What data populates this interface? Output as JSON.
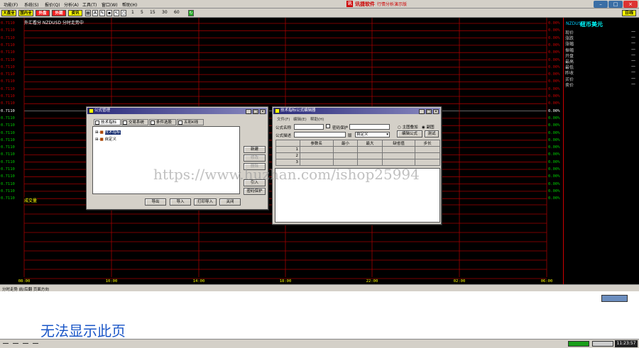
{
  "menubar": {
    "items": [
      "功能(F)",
      "系统(S)",
      "报价(Q)",
      "分析(A)",
      "工具(T)",
      "窗口(W)",
      "帮助(H)"
    ],
    "app_logo": "讯",
    "app_title": "讯捷软件",
    "app_subtitle": "行情分析演示版"
  },
  "toolbar": {
    "buttons": [
      {
        "label": "大盘全",
        "bg": "#ffff00",
        "fg": "#000000"
      },
      {
        "label": "国内全",
        "bg": "#ffff00",
        "fg": "#000000"
      },
      {
        "label": "外盘",
        "bg": "#ff2020",
        "fg": "#ffffff"
      },
      {
        "label": "外期",
        "bg": "#ff2020",
        "fg": "#ffffff"
      },
      {
        "label": "资讯",
        "bg": "#ffff00",
        "fg": "#000000"
      }
    ],
    "icons": [
      "grid-icon",
      "text-icon",
      "pencil-icon",
      "lock-icon",
      "arrow-icon",
      "search-icon"
    ],
    "periods": [
      "1",
      "5",
      "15",
      "30",
      "60"
    ],
    "refresh_icon": "refresh-icon",
    "right_button": "日线"
  },
  "chart": {
    "info": "外汇看分 NZDUSD 分时走势中",
    "price_labels": [
      "0.7110",
      "0.7110",
      "0.7110",
      "0.7110",
      "0.7110",
      "0.7110",
      "0.7110",
      "0.7110",
      "0.7110",
      "0.7110",
      "0.7110",
      "0.7110",
      "0.7110",
      "0.7110",
      "0.7110",
      "0.7110",
      "0.7110",
      "0.7110",
      "0.7110",
      "0.7110",
      "0.7110",
      "0.7110",
      "0.7110",
      "0.7110",
      "0.7110"
    ],
    "pct_labels": [
      "0.00%",
      "0.00%",
      "0.00%",
      "0.00%",
      "0.00%",
      "0.00%",
      "0.00%",
      "0.00%",
      "0.00%",
      "0.00%",
      "0.00%",
      "0.00%",
      "0.00%",
      "0.00%",
      "0.00%",
      "0.00%",
      "0.00%",
      "0.00%",
      "0.00%",
      "0.00%",
      "0.00%",
      "0.00%",
      "0.00%",
      "0.00%",
      "0.00%"
    ],
    "time_labels": [
      "08:00",
      "10:00",
      "14:00",
      "18:00",
      "22:00",
      "02:00",
      "06:00"
    ],
    "volume_label": "成交量",
    "colors": {
      "up": "#cc0000",
      "down": "#00cc00",
      "base": "#ffffff",
      "grid": "#a00000",
      "axis": "#ffff00"
    }
  },
  "rightpanel": {
    "code": "NZDUSD",
    "name": "纽币美元",
    "rows": [
      {
        "label": "现价",
        "value": "—"
      },
      {
        "label": "涨跌",
        "value": "—"
      },
      {
        "label": "涨幅",
        "value": "—"
      },
      {
        "label": "振幅",
        "value": "—"
      },
      {
        "label": "开盘",
        "value": "—"
      },
      {
        "label": "最高",
        "value": "—"
      },
      {
        "label": "最低",
        "value": "—"
      },
      {
        "label": "昨收",
        "value": "—"
      },
      {
        "label": "买价",
        "value": "—"
      },
      {
        "label": "卖价",
        "value": "—"
      }
    ]
  },
  "status": {
    "text": "分时走势 前/后翻 页面方向"
  },
  "formula_manager": {
    "title": "公式管理",
    "tabs": [
      "技术指标",
      "交易系统",
      "条件选股",
      "五彩K线"
    ],
    "tree": [
      {
        "prefix": "⊞-",
        "label": "技术指标",
        "selected": true
      },
      {
        "prefix": "⊞-",
        "label": "自定义",
        "selected": false
      }
    ],
    "side_buttons": [
      {
        "label": "新建",
        "disabled": false
      },
      {
        "label": "修改",
        "disabled": true
      },
      {
        "label": "删除",
        "disabled": true
      },
      {
        "label": "引入",
        "disabled": false
      },
      {
        "label": "密码保护",
        "disabled": false
      }
    ],
    "bottom_buttons": [
      "导出",
      "导入",
      "打印导入",
      "关闭"
    ]
  },
  "formula_editor": {
    "title": "技术指标公式编辑器",
    "menus": [
      "文件(F)",
      "编辑(E)",
      "帮助(H)"
    ],
    "name_label": "公式名称",
    "password_label": "密码保护",
    "desc_label": "公式描述",
    "version_label": "版",
    "custom_value": "自定义",
    "radio_main": "主图叠加",
    "radio_sub": "副图",
    "edit_button": "编辑公式",
    "test_button": "测试",
    "param_headers": [
      "参数名",
      "最小",
      "最大",
      "缺省值",
      "步长"
    ],
    "param_rows": [
      "1",
      "2",
      "3"
    ]
  },
  "watermark": "https://www.huzhan.com/ishop25994",
  "browser": {
    "error": "无法显示此页"
  },
  "taskbar": {
    "clock": "11:23:57"
  }
}
